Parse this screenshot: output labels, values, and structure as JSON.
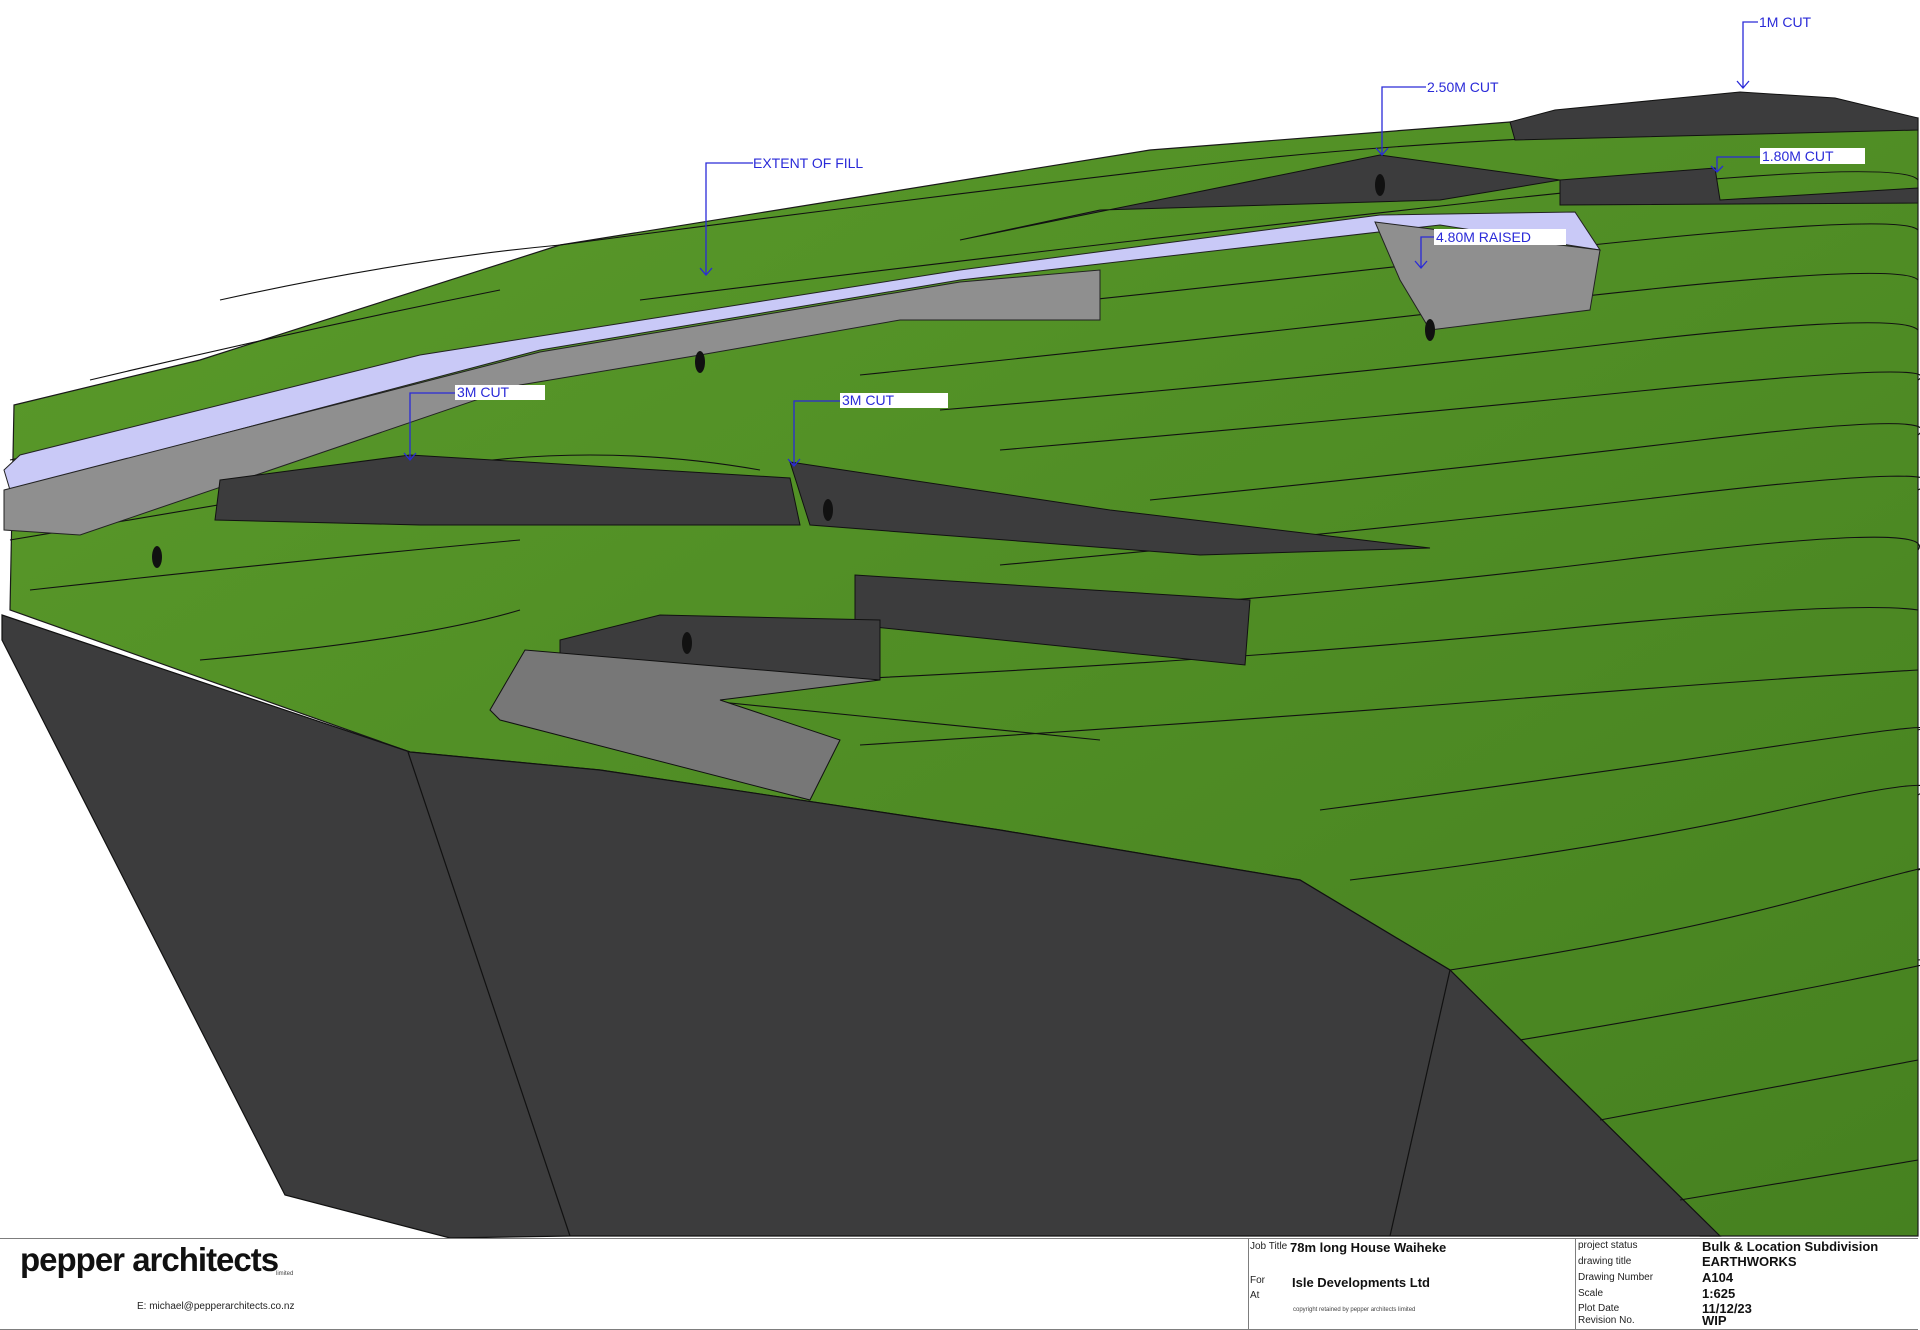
{
  "callouts": {
    "cut_1m": "1M CUT",
    "cut_2_50m": "2.50M CUT",
    "cut_1_80m": "1.80M CUT",
    "extent_of_fill": "EXTENT OF FILL",
    "raised_4_80m": "4.80M RAISED",
    "cut_3m_left": "3M CUT",
    "cut_3m_right": "3M CUT"
  },
  "colors": {
    "grass": "#4e8a23",
    "grass_dark": "#3f7419",
    "earth_face": "#3c3c3d",
    "retaining_wall": "#8f8f8f",
    "fill_area": "#c9c9f7",
    "callout": "#2a2ad8",
    "contour": "#1a1a1a"
  },
  "title_block": {
    "firm": "pepper architects",
    "firm_suffix": "limited",
    "email": "E: michael@pepperarchitects.co.nz",
    "job_title_label": "Job Title",
    "job_title": "78m long House Waiheke",
    "for_label": "For",
    "at_label": "At",
    "client": "Isle Developments Ltd",
    "copyright": "copyright retained by pepper architects limited",
    "project_status_label": "project status",
    "project_status": "Bulk & Location Subdivision",
    "drawing_title_label": "drawing title",
    "drawing_title": "EARTHWORKS",
    "drawing_number_label": "Drawing Number",
    "drawing_number": "A104",
    "scale_label": "Scale",
    "scale": "1:625",
    "plot_date_label": "Plot Date",
    "plot_date": "11/12/23",
    "revision_label": "Revision No.",
    "revision": "WIP"
  }
}
